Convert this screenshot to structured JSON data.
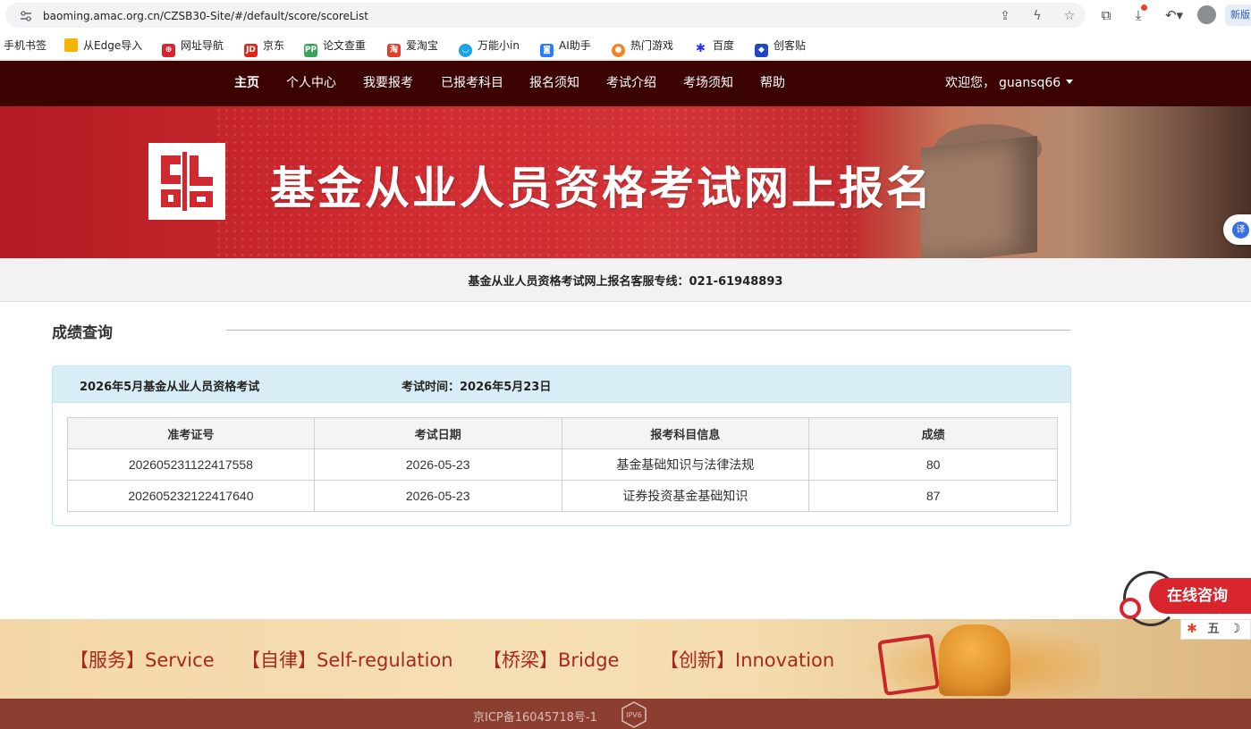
{
  "browser": {
    "url": "baoming.amac.org.cn/CZSB30-Site/#/default/score/scoreList",
    "new_tab_label": "新版",
    "bookmarks": [
      {
        "label": "手机书签",
        "icon": "none",
        "color": ""
      },
      {
        "label": "从Edge导入",
        "icon": "folder-icon",
        "color": "#f4b400"
      },
      {
        "label": "网址导航",
        "icon": "nav-icon",
        "color": "#d8242c"
      },
      {
        "label": "京东",
        "icon": "jd-icon",
        "color": "#e1251b"
      },
      {
        "label": "论文查重",
        "icon": "pp-icon",
        "color": "#3aa35a"
      },
      {
        "label": "爱淘宝",
        "icon": "taobao-icon",
        "color": "#e23d28"
      },
      {
        "label": "万能小in",
        "icon": "robot-icon",
        "color": "#1ca3e5"
      },
      {
        "label": "AI助手",
        "icon": "chat-icon",
        "color": "#2a7bff"
      },
      {
        "label": "热门游戏",
        "icon": "game-icon",
        "color": "#f5821f"
      },
      {
        "label": "百度",
        "icon": "baidu-paw-icon",
        "color": "#2932e1"
      },
      {
        "label": "创客贴",
        "icon": "ckt-icon",
        "color": "#2148c0"
      }
    ]
  },
  "nav": {
    "items": [
      "主页",
      "个人中心",
      "我要报考",
      "已报考科目",
      "报名须知",
      "考试介绍",
      "考场须知",
      "帮助"
    ],
    "active": "主页",
    "user_greeting": "欢迎您，",
    "username": "guansq66"
  },
  "banner": {
    "title": "基金从业人员资格考试网上报名",
    "logo_icon": "amac-seal-logo"
  },
  "hotline": "基金从业人员资格考试网上报名客服专线：021-61948893",
  "score": {
    "section_title": "成绩查询",
    "exam_name": "2026年5月基金从业人员资格考试",
    "exam_time_label": "考试时间：",
    "exam_time": "2026年5月23日",
    "columns": [
      "准考证号",
      "考试日期",
      "报考科目信息",
      "成绩"
    ],
    "rows": [
      [
        "202605231122417558",
        "2026-05-23",
        "基金基础知识与法律法规",
        "80"
      ],
      [
        "202605232122417640",
        "2026-05-23",
        "证券投资基金基础知识",
        "87"
      ]
    ]
  },
  "widgets": {
    "translate_label": "译",
    "consult_label": "在线咨询",
    "ime": [
      "五",
      "☽"
    ]
  },
  "footer": {
    "mottos": [
      "【服务】Service",
      "【自律】Self-regulation",
      "【桥梁】Bridge",
      "【创新】Innovation"
    ],
    "icp": "京ICP备16045718号-1",
    "ipv6_label": "IPV6"
  },
  "colors": {
    "nav_bg": "#3b0403",
    "banner_red": "#cf2a30",
    "panel_head": "#d9edf7",
    "motto_text": "#a8281e",
    "footer_bottom": "#8c3f31"
  }
}
